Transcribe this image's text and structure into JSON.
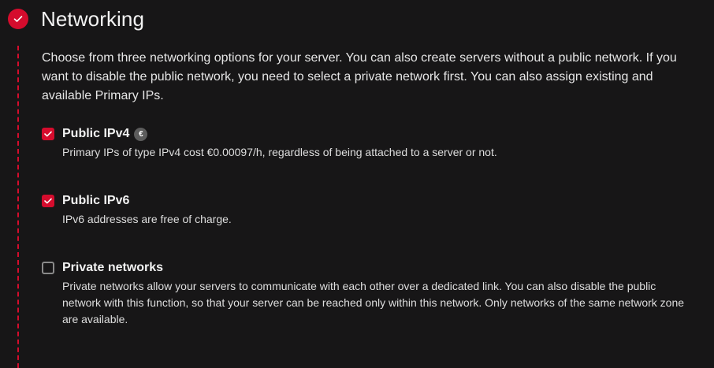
{
  "section": {
    "title": "Networking",
    "status_icon": "check-icon",
    "accent_color": "#d50c2d",
    "intro": "Choose from three networking options for your server. You can also create servers without a public network. If you want to disable the public network, you need to select a private network first. You can also assign existing and available Primary IPs."
  },
  "options": [
    {
      "label": "Public IPv4",
      "checked": true,
      "price_badge": "€",
      "description": "Primary IPs of type IPv4 cost €0.00097/h, regardless of being attached to a server or not."
    },
    {
      "label": "Public IPv6",
      "checked": true,
      "description": "IPv6 addresses are free of charge."
    },
    {
      "label": "Private networks",
      "checked": false,
      "description": "Private networks allow your servers to communicate with each other over a dedicated link. You can also disable the public network with this function, so that your server can be reached only within this network. Only networks of the same network zone are available."
    }
  ]
}
